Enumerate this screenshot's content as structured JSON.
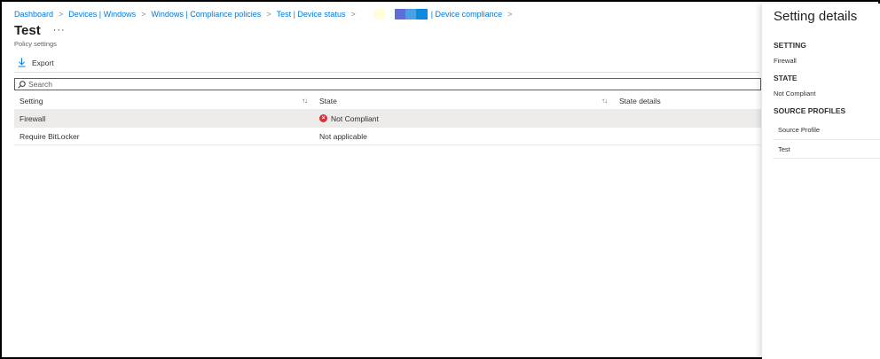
{
  "breadcrumb": {
    "items": [
      "Dashboard",
      "Devices | Windows",
      "Windows | Compliance policies",
      "Test | Device status"
    ],
    "separator": ">",
    "last_item": "| Device compliance",
    "redacted_colors": [
      "#fefde0",
      "#5b6fd4",
      "#47a3e6",
      "#1188e0"
    ]
  },
  "page": {
    "title": "Test",
    "more_glyph": "···",
    "subtitle": "Policy settings"
  },
  "toolbar": {
    "export_label": "Export",
    "export_icon": "download-icon"
  },
  "search": {
    "placeholder": "Search",
    "value": ""
  },
  "table": {
    "columns": [
      "Setting",
      "State",
      "State details"
    ],
    "sort_glyph": "↑↓",
    "rows": [
      {
        "setting": "Firewall",
        "state": "Not Compliant",
        "state_icon": "error-circle-icon",
        "state_details": "",
        "selected": true
      },
      {
        "setting": "Require BitLocker",
        "state": "Not applicable",
        "state_details": "",
        "selected": false
      }
    ]
  },
  "details_pane": {
    "title": "Setting details",
    "setting_heading": "SETTING",
    "setting_value": "Firewall",
    "state_heading": "STATE",
    "state_value": "Not Compliant",
    "source_heading": "SOURCE PROFILES",
    "source_column": "Source Profile",
    "source_rows": [
      "Test"
    ]
  },
  "colors": {
    "link": "#0078d4",
    "error": "#d13438",
    "selected_row": "#edebe9"
  }
}
